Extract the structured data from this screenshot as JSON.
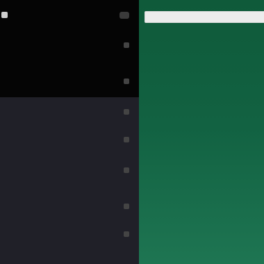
{
  "app": {
    "title": ""
  },
  "sidebar": {
    "items": [
      {
        "label": "",
        "meta": ""
      },
      {
        "label": "",
        "meta": ""
      },
      {
        "label": "",
        "meta": ""
      },
      {
        "label": "",
        "meta": ""
      },
      {
        "label": "",
        "meta": ""
      },
      {
        "label": "",
        "meta": ""
      },
      {
        "label": "",
        "meta": ""
      }
    ]
  },
  "main": {
    "search": {
      "value": "",
      "placeholder": ""
    },
    "table": {
      "headers": [
        "",
        "",
        ""
      ],
      "rows": [
        [
          "",
          "",
          ""
        ],
        [
          "",
          "",
          ""
        ],
        [
          "",
          "",
          ""
        ],
        [
          "",
          "",
          ""
        ],
        [
          "",
          "",
          ""
        ],
        [
          "",
          "",
          ""
        ],
        [
          "",
          "",
          ""
        ],
        [
          "",
          "",
          ""
        ],
        [
          "",
          "",
          ""
        ],
        [
          "",
          "",
          ""
        ]
      ]
    }
  },
  "colors": {
    "sidebar_top": "#050505",
    "sidebar_bottom": "#202028",
    "main_panel": "#126242",
    "search_field": "#ececec",
    "text_light": "#d9d9d9"
  },
  "icons": {
    "app": "app-icon",
    "header_action": "more-icon",
    "row_action": "row-action-icon"
  }
}
